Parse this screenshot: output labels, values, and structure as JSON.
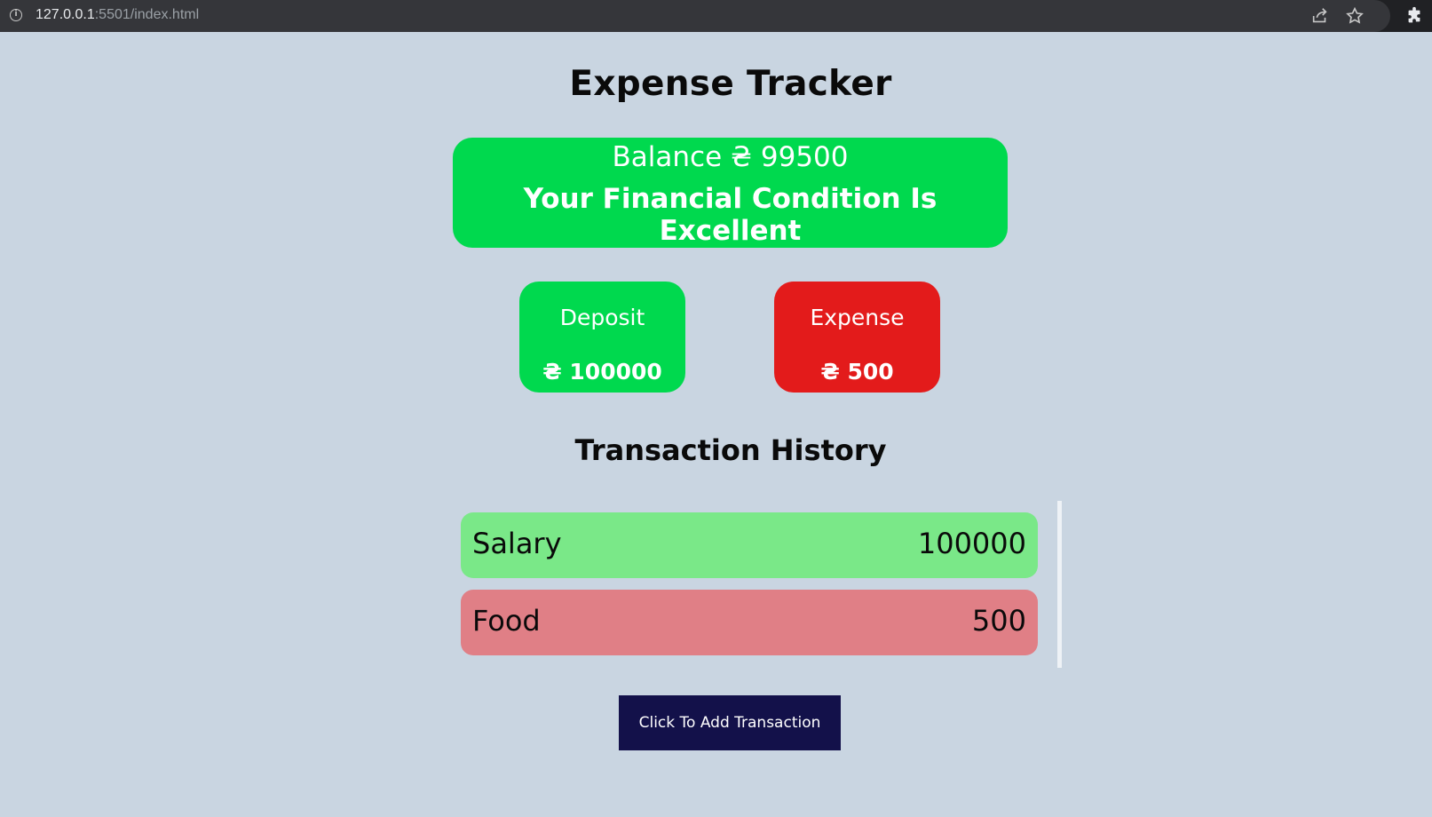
{
  "browser": {
    "url_host": "127.0.0.1",
    "url_rest": ":5501/index.html",
    "icons": [
      "info-icon",
      "share-icon",
      "star-icon",
      "extensions-icon"
    ]
  },
  "page": {
    "title": "Expense Tracker"
  },
  "balance": {
    "text": "Balance ₴ 99500",
    "condition": "Your Financial Condition Is Excellent"
  },
  "stats": {
    "deposit": {
      "label": "Deposit",
      "value": "₴ 100000"
    },
    "expense": {
      "label": "Expense",
      "value": "₴ 500"
    }
  },
  "history": {
    "title": "Transaction History",
    "transactions": [
      {
        "name": "Salary",
        "amount": "100000",
        "type": "income"
      },
      {
        "name": "Food",
        "amount": "500",
        "type": "expense"
      }
    ]
  },
  "actions": {
    "add_transaction_label": "Click To Add Transaction"
  },
  "colors": {
    "background": "#c9d5e1",
    "positive": "#00d94e",
    "negative": "#e31b1b",
    "income_row": "#7ae888",
    "expense_row": "#e07f86",
    "button": "#13114a"
  }
}
